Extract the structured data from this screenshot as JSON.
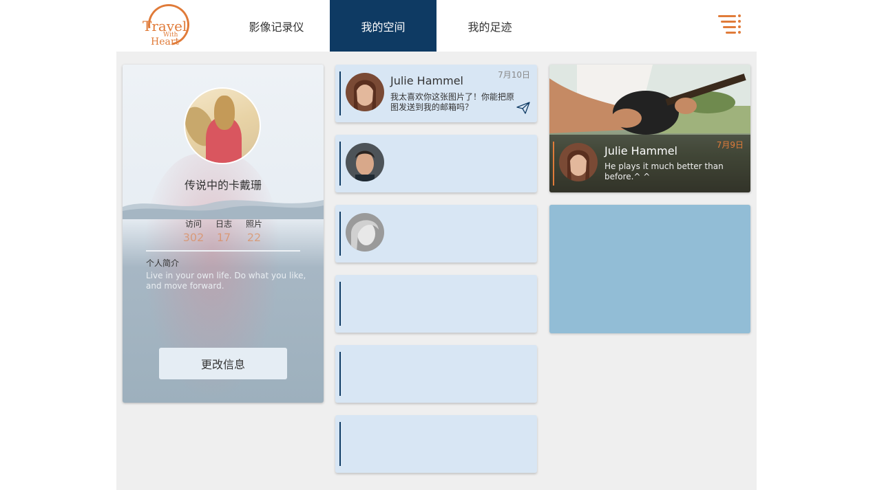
{
  "header": {
    "logo": {
      "line1": "Travel",
      "line2": "With",
      "line3": "Heart"
    },
    "nav": [
      {
        "label": "影像记录仪",
        "active": false
      },
      {
        "label": "我的空间",
        "active": true
      },
      {
        "label": "我的足迹",
        "active": false
      }
    ],
    "menu_icon": "menu-lines-icon"
  },
  "profile": {
    "name": "传说中的卡戴珊",
    "stats": [
      {
        "label": "访问",
        "value": "302"
      },
      {
        "label": "日志",
        "value": "17"
      },
      {
        "label": "照片",
        "value": "22"
      }
    ],
    "intro_title": "个人简介",
    "intro_text": "Live in your own life. Do what you like, and move forward.",
    "edit_button": "更改信息"
  },
  "messages": [
    {
      "name": "Julie Hammel",
      "date": "7月10日",
      "text": "我太喜欢你这张图片了！你能把原图发送到我的邮箱吗？"
    }
  ],
  "photo_card": {
    "name": "Julie Hammel",
    "date": "7月9日",
    "text": "He plays it much better than before.^ ^"
  },
  "colors": {
    "accent": "#e07b39",
    "nav_active": "#0e3a63",
    "message_bg": "#d8e6f4",
    "blue_box": "#92bdd6"
  }
}
